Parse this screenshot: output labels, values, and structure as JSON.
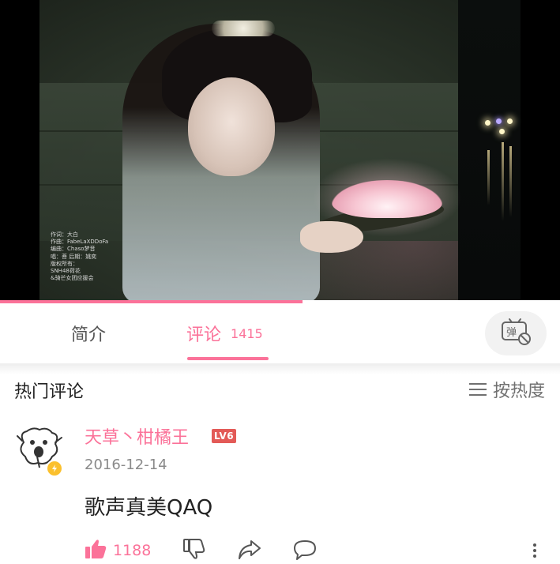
{
  "video": {
    "credits": [
      "作词：大白",
      "作曲：FabeLaXDDoFa",
      "编曲：Chaso梦音",
      "唱：菩 后期：姚奕",
      "版权所有：",
      "SNH48荷花",
      "&骑芒女团应援会"
    ],
    "progress_fraction": 0.54
  },
  "tabs": {
    "intro_label": "简介",
    "comments_label": "评论",
    "comments_count": "1415",
    "danmaku_icon": "danmaku-off-icon"
  },
  "hot_comments": {
    "title": "热门评论",
    "sort_label": "按热度"
  },
  "comment": {
    "username": "天草丶柑橘王",
    "level": "LV6",
    "date": "2016-12-14",
    "text": "歌声真美QAQ",
    "like_count": "1188"
  },
  "colors": {
    "accent": "#fb7299",
    "level_badge": "#e35a57",
    "muted_text": "#8a8a8a"
  }
}
